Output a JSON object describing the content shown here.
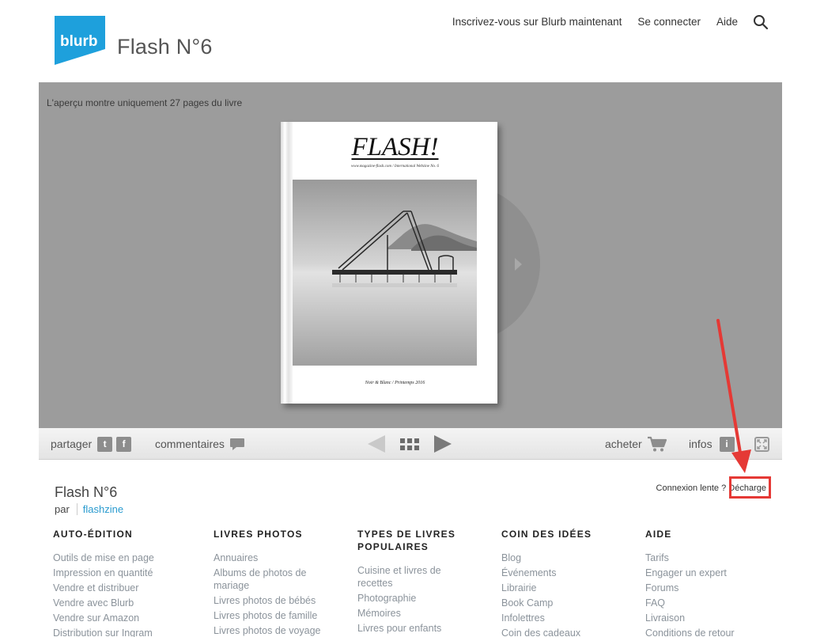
{
  "header": {
    "logo_text": "blurb",
    "book_title": "Flash N°6",
    "nav": [
      {
        "label": "Inscrivez-vous sur Blurb maintenant"
      },
      {
        "label": "Se connecter"
      },
      {
        "label": "Aide"
      }
    ],
    "search_icon": "search-icon"
  },
  "viewer": {
    "preview_note": "L'aperçu montre uniquement 27 pages du livre",
    "cover": {
      "title": "FLASH!",
      "subtitle": "www.magazine-flash.com / International Webzine No. 6",
      "footer": "Noir & Blanc / Printemps 2016"
    }
  },
  "toolbar": {
    "share_label": "partager",
    "twitter_letter": "t",
    "facebook_letter": "f",
    "comments_label": "commentaires",
    "buy_label": "acheter",
    "info_label": "infos",
    "info_letter": "i"
  },
  "book_info": {
    "title": "Flash N°6",
    "by_label": "par",
    "author": "flashzine",
    "slow_connection_label": "Connexion lente ?",
    "download_label": "Décharge"
  },
  "annotation": {
    "color": "#e53935"
  },
  "footer": {
    "columns": [
      {
        "heading": "AUTO-ÉDITION",
        "links": [
          "Outils de mise en page",
          "Impression en quantité",
          "Vendre et distribuer",
          "Vendre avec Blurb",
          "Vendre sur Amazon",
          "Distribution sur Ingram"
        ]
      },
      {
        "heading": "LIVRES PHOTOS",
        "links": [
          "Annuaires",
          "Albums de photos de mariage",
          "Livres photos de bébés",
          "Livres photos de famille",
          "Livres photos de voyage"
        ]
      },
      {
        "heading": "TYPES DE LIVRES POPULAIRES",
        "links": [
          "Cuisine et livres de recettes",
          "Photographie",
          "Mémoires",
          "Livres pour enfants"
        ]
      },
      {
        "heading": "COIN DES IDÉES",
        "links": [
          "Blog",
          "Événements",
          "Librairie",
          "Book Camp",
          "Infolettres",
          "Coin des cadeaux"
        ]
      },
      {
        "heading": "AIDE",
        "links": [
          "Tarifs",
          "Engager un expert",
          "Forums",
          "FAQ",
          "Livraison",
          "Conditions de retour"
        ]
      }
    ]
  },
  "colors": {
    "brand": "#1ea0dc",
    "link": "#2a9bcf",
    "viewer_bg": "#9c9c9c",
    "footer_link": "#8b939b"
  }
}
